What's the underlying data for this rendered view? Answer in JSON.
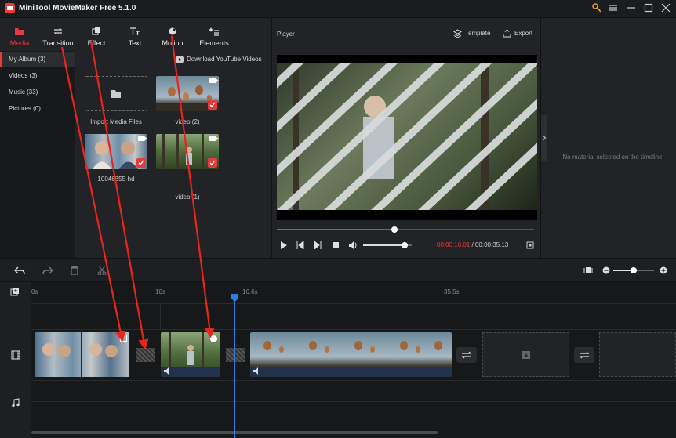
{
  "app": {
    "title": "MiniTool MovieMaker Free 5.1.0"
  },
  "tabs": [
    {
      "label": "Media",
      "active": true
    },
    {
      "label": "Transition"
    },
    {
      "label": "Effect"
    },
    {
      "label": "Text"
    },
    {
      "label": "Motion"
    },
    {
      "label": "Elements"
    }
  ],
  "sidebar": {
    "items": [
      {
        "label": "My Album  (3)",
        "active": true
      },
      {
        "label": "Videos  (3)"
      },
      {
        "label": "Music  (33)"
      },
      {
        "label": "Pictures  (0)"
      }
    ]
  },
  "media": {
    "download_label": "Download YouTube Videos",
    "import_label": "Import Media Files",
    "items": [
      {
        "caption": "video (2)",
        "checked": true
      },
      {
        "caption": "10046855-hd",
        "checked": true
      },
      {
        "caption": "video (1)",
        "checked": true
      }
    ]
  },
  "player": {
    "label": "Player",
    "template_label": "Template",
    "export_label": "Export",
    "current_time": "00:00:16.01",
    "separator": "/",
    "total_time": "00:00:35.13",
    "progress": 0.456,
    "volume": 0.85
  },
  "properties": {
    "empty_text": "No material selected on the timeline"
  },
  "timeline": {
    "ticks": [
      "0s",
      "10s",
      "16.6s",
      "35.5s"
    ],
    "zoom_level": 0.5
  },
  "colors": {
    "accent": "#e53b3b",
    "playhead": "#2f7de1"
  }
}
